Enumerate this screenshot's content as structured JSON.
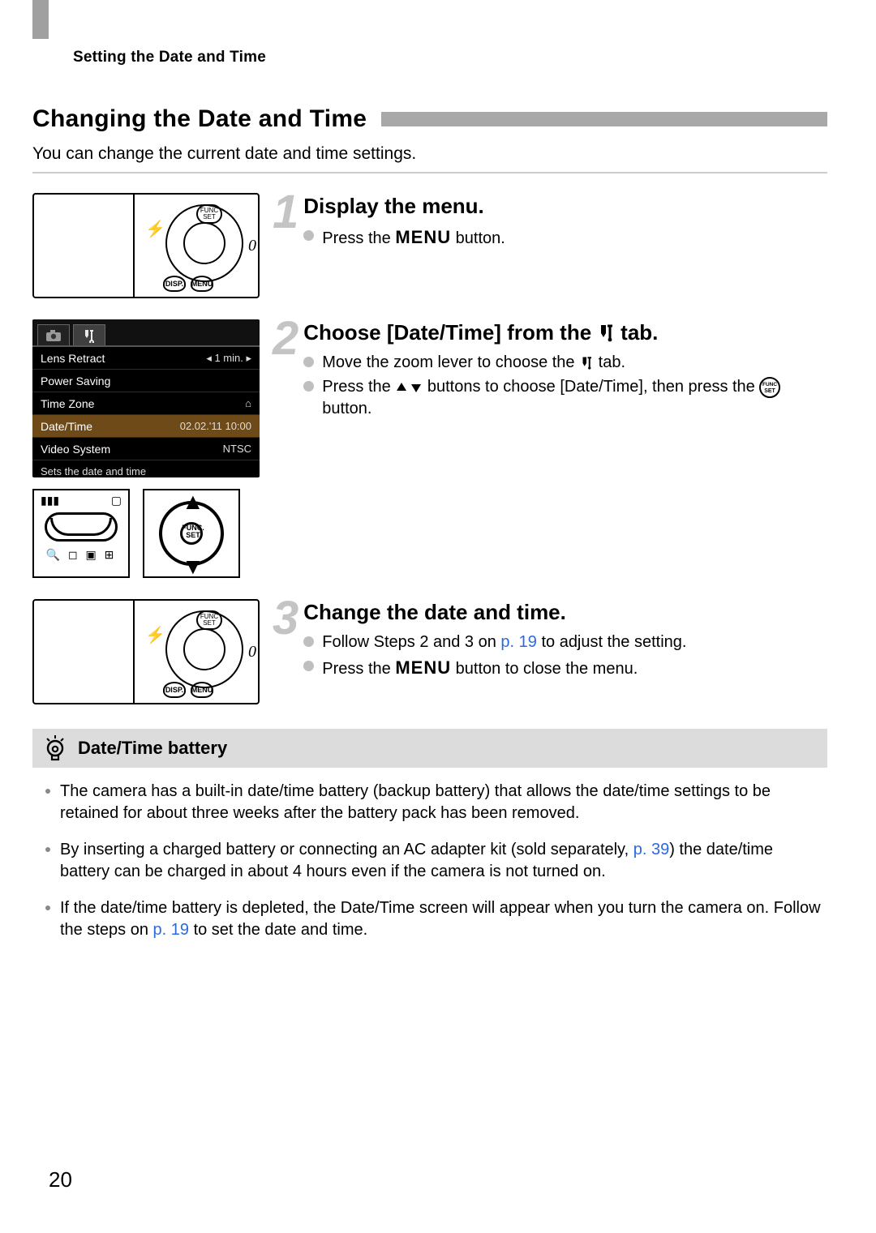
{
  "running_head": "Setting the Date and Time",
  "section": {
    "title": "Changing the Date and Time",
    "intro": "You can change the current date and time settings."
  },
  "steps": {
    "s1": {
      "num": "1",
      "title": "Display the menu.",
      "b1_a": "Press the ",
      "b1_menu": "MENU",
      "b1_b": " button."
    },
    "s2": {
      "num": "2",
      "title_a": "Choose [Date/Time] from the ",
      "title_b": "tab.",
      "b1_a": "Move the zoom lever to choose the ",
      "b1_b": " tab.",
      "b2_a": "Press the ",
      "b2_b": " buttons to choose [Date/Time], then press the ",
      "b2_c": " button."
    },
    "s3": {
      "num": "3",
      "title": "Change the date and time.",
      "b1_a": "Follow Steps 2 and 3 on ",
      "b1_link": "p. 19",
      "b1_b": " to adjust the setting.",
      "b2_a": "Press the ",
      "b2_menu": "MENU",
      "b2_b": " button to close the menu."
    }
  },
  "lcd": {
    "r1": {
      "label": "Lens Retract",
      "value": "1 min."
    },
    "r2": {
      "label": "Power Saving",
      "value": ""
    },
    "r3": {
      "label": "Time Zone",
      "value": ""
    },
    "r4": {
      "label": "Date/Time",
      "value": "02.02.'11 10:00"
    },
    "r5": {
      "label": "Video System",
      "value": "NTSC"
    },
    "help": "Sets the date and time"
  },
  "callout": {
    "title": "Date/Time battery"
  },
  "tips": {
    "t1": "The camera has a built-in date/time battery (backup battery) that allows the date/time settings to be retained for about three weeks after the battery pack has been removed.",
    "t2_a": "By inserting a charged battery or connecting an AC adapter kit (sold separately, ",
    "t2_link": "p. 39",
    "t2_b": ") the date/time battery can be charged in about 4 hours even if the camera is not turned on.",
    "t3_a": "If the date/time battery is depleted, the Date/Time screen will appear when you turn the camera on. Follow the steps on ",
    "t3_link": "p. 19",
    "t3_b": " to set the date and time."
  },
  "page_number": "20"
}
